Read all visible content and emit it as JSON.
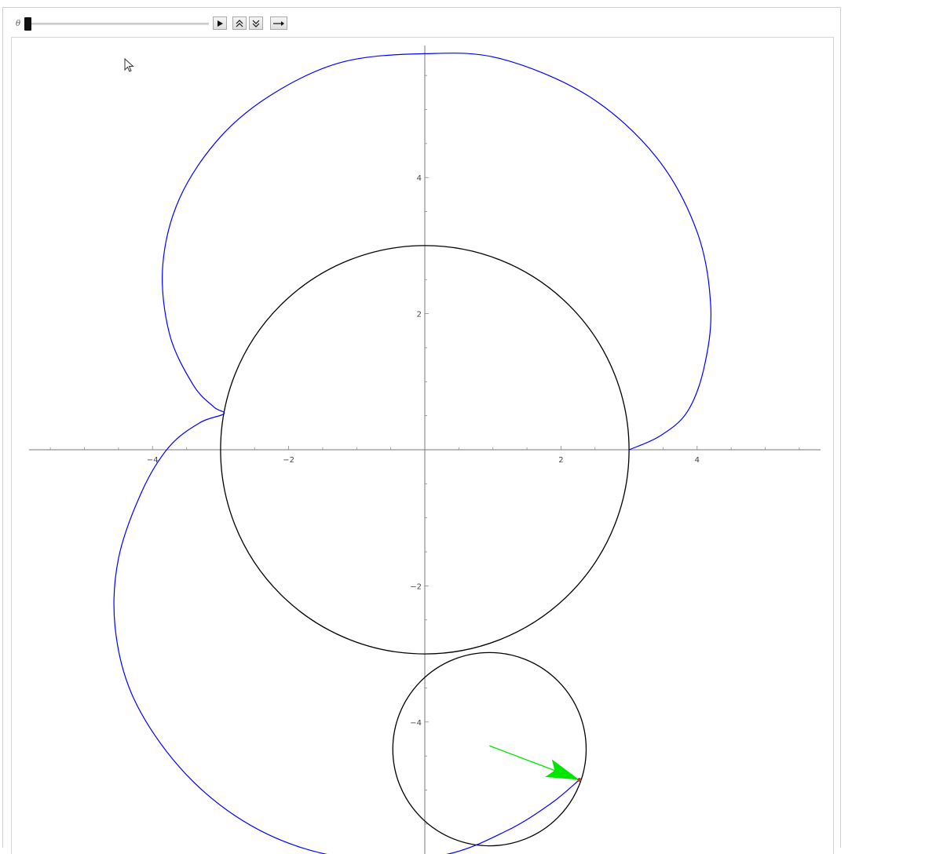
{
  "controls": {
    "slider_label": "θ",
    "slider_value": 0,
    "buttons": [
      {
        "name": "play-button",
        "icon": "play-icon"
      },
      {
        "name": "faster-button",
        "icon": "double-chevron-up-icon"
      },
      {
        "name": "slower-button",
        "icon": "double-chevron-down-icon"
      },
      {
        "name": "direction-button",
        "icon": "arrow-right-icon"
      }
    ]
  },
  "chart_data": {
    "type": "line",
    "title": "",
    "xlabel": "",
    "ylabel": "",
    "xlim": [
      -5.8,
      5.8
    ],
    "ylim": [
      -5.8,
      5.8
    ],
    "x_ticks": [
      "−4",
      "−2",
      "2",
      "4"
    ],
    "y_ticks": [
      "4",
      "2",
      "−2",
      "−4"
    ],
    "x_tick_values": [
      -4,
      -2,
      2,
      4
    ],
    "y_tick_values": [
      4,
      2,
      -2,
      -4
    ],
    "grid": false,
    "fixed_circle": {
      "center": [
        0,
        0
      ],
      "radius": 3,
      "color": "#000000"
    },
    "rolling_circle": {
      "center": [
        0.95,
        -4.4
      ],
      "radius": 1.42,
      "color": "#000000"
    },
    "curve": {
      "color": "#0000ff",
      "points": [
        [
          3.0,
          0.0
        ],
        [
          3.45,
          0.2
        ],
        [
          3.85,
          0.55
        ],
        [
          4.1,
          1.2
        ],
        [
          4.2,
          2.1
        ],
        [
          4.0,
          3.2
        ],
        [
          3.4,
          4.3
        ],
        [
          2.4,
          5.2
        ],
        [
          1.1,
          5.75
        ],
        [
          0.0,
          5.82
        ],
        [
          -1.2,
          5.7
        ],
        [
          -2.2,
          5.25
        ],
        [
          -3.0,
          4.6
        ],
        [
          -3.6,
          3.7
        ],
        [
          -3.85,
          2.7
        ],
        [
          -3.75,
          1.7
        ],
        [
          -3.4,
          0.95
        ],
        [
          -3.1,
          0.63
        ],
        [
          -2.95,
          0.53
        ],
        [
          -3.3,
          0.4
        ],
        [
          -3.75,
          0.05
        ],
        [
          -4.15,
          -0.6
        ],
        [
          -4.5,
          -1.6
        ],
        [
          -4.55,
          -2.6
        ],
        [
          -4.3,
          -3.6
        ],
        [
          -3.7,
          -4.55
        ],
        [
          -2.9,
          -5.3
        ],
        [
          -1.95,
          -5.8
        ],
        [
          -0.9,
          -6.02
        ],
        [
          0.3,
          -5.95
        ],
        [
          1.2,
          -5.6
        ],
        [
          1.85,
          -5.2
        ],
        [
          2.27,
          -4.85
        ]
      ]
    },
    "tracer_point": {
      "x": 2.27,
      "y": -4.85,
      "color": "#c0392b"
    },
    "velocity_arrow": {
      "from": [
        0.95,
        -4.35
      ],
      "to": [
        2.27,
        -4.85
      ],
      "color": "#00e600"
    }
  }
}
